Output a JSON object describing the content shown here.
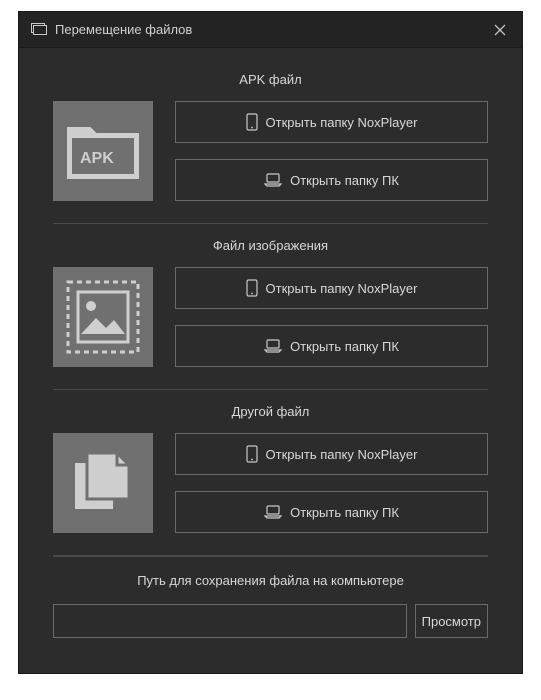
{
  "window": {
    "title": "Перемещение файлов"
  },
  "sections": {
    "apk": {
      "title": "APK файл",
      "icon_text": "APK",
      "btn_nox": "Открыть папку NoxPlayer",
      "btn_pc": "Открыть папку ПК"
    },
    "image": {
      "title": "Файл изображения",
      "btn_nox": "Открыть папку NoxPlayer",
      "btn_pc": "Открыть папку ПК"
    },
    "other": {
      "title": "Другой файл",
      "btn_nox": "Открыть папку NoxPlayer",
      "btn_pc": "Открыть папку ПК"
    }
  },
  "savepath": {
    "label": "Путь для сохранения файла на компьютере",
    "value": "",
    "browse": "Просмотр"
  }
}
